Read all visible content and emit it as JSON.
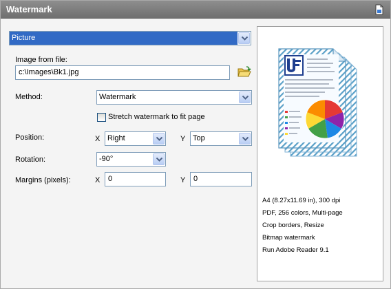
{
  "panel": {
    "title": "Watermark",
    "title_icon": "document-icon"
  },
  "type_select": {
    "value": "Picture"
  },
  "image_file": {
    "label": "Image from file:",
    "value": "c:\\Images\\Bk1.jpg",
    "browse_icon": "folder-open-icon"
  },
  "method": {
    "label": "Method:",
    "value": "Watermark"
  },
  "stretch": {
    "label": "Stretch watermark to fit page",
    "checked": false
  },
  "position": {
    "label": "Position:",
    "x_label": "X",
    "x_value": "Right",
    "y_label": "Y",
    "y_value": "Top"
  },
  "rotation": {
    "label": "Rotation:",
    "value": "-90°"
  },
  "margins": {
    "label": "Margins (pixels):",
    "x_label": "X",
    "x_value": "0",
    "y_label": "Y",
    "y_value": "0"
  },
  "preview": {
    "icon": "document-pie-chart-icon",
    "info": [
      "A4 (8.27x11.69 in), 300 dpi",
      "PDF, 256 colors, Multi-page",
      "Crop borders, Resize",
      "Bitmap watermark",
      "Run Adobe Reader 9.1"
    ]
  },
  "colors": {
    "titlebar": "#7a7a7a",
    "selection": "#316ac5",
    "border": "#7f9db9"
  }
}
